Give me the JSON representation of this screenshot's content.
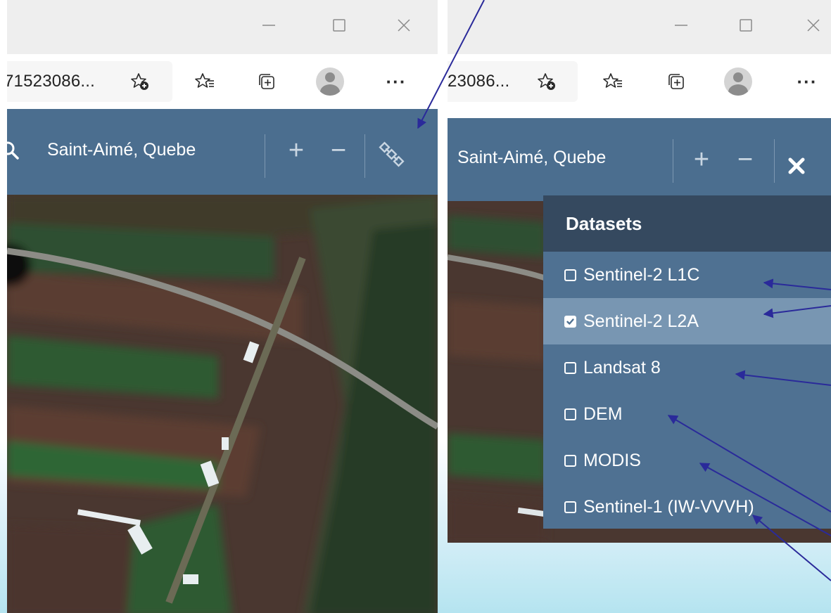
{
  "left": {
    "address": "71523086...",
    "location": "Saint-Aimé, Quebe"
  },
  "right": {
    "address": "23086...",
    "location": "Saint-Aimé, Quebe",
    "datasets": {
      "header": "Datasets",
      "items": [
        {
          "label": "Sentinel-2 L1C",
          "checked": false
        },
        {
          "label": "Sentinel-2 L2A",
          "checked": true
        },
        {
          "label": "Landsat 8",
          "checked": false
        },
        {
          "label": "DEM",
          "checked": false
        },
        {
          "label": "MODIS",
          "checked": false
        },
        {
          "label": "Sentinel-1 (IW-VVVH)",
          "checked": false
        }
      ]
    }
  },
  "toolbar": {
    "more_label": "···",
    "zoom_in_label": "+",
    "zoom_out_label": "−"
  },
  "icons": {
    "minimize": "minimize-icon",
    "maximize": "maximize-icon",
    "close": "close-icon",
    "add_favorite": "star-plus-icon",
    "favorites": "favorites-icon",
    "collections": "collections-icon",
    "profile": "avatar-icon",
    "search": "search-icon",
    "satellite": "satellite-icon",
    "close_menu": "close-x-icon"
  },
  "colors": {
    "appbar": "#4b6e8f",
    "menu_header": "#35495f",
    "menu_bg": "#4f7192",
    "menu_selected": "#7896b2",
    "annotation_arrow": "#2a2a9a"
  }
}
